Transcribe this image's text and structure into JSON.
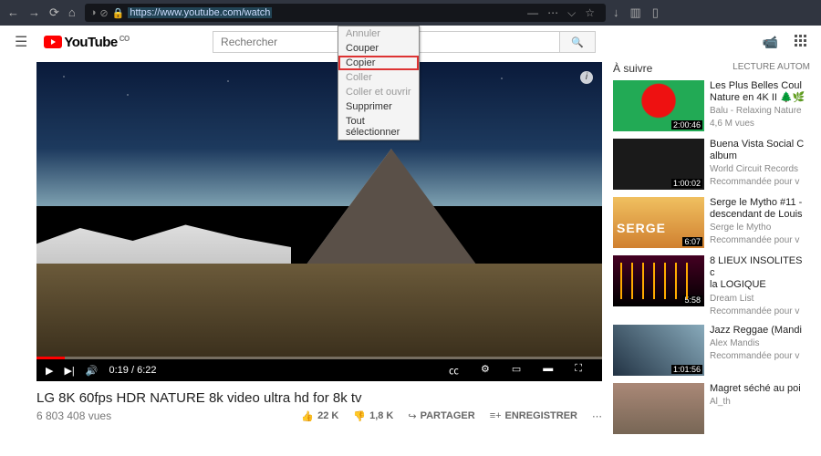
{
  "browser": {
    "url_visible": "https://www.youtube.com/watch",
    "nav": {
      "back": "←",
      "fwd": "→",
      "reload": "⟳",
      "home": "⌂"
    },
    "tail": {
      "reader": "—",
      "menu": "⋯",
      "pocket": "⌵",
      "star": "☆"
    },
    "right": {
      "download": "↓",
      "library": "▥",
      "sidebar": "▯"
    }
  },
  "context_menu": {
    "items": [
      "Annuler",
      "Couper",
      "Copier",
      "Coller",
      "Coller et ouvrir",
      "Supprimer",
      "Tout sélectionner"
    ],
    "highlighted": "Copier"
  },
  "yt": {
    "logo_text": "YouTube",
    "logo_tag": "CO",
    "search_placeholder": "Rechercher"
  },
  "video": {
    "title": "LG 8K 60fps HDR NATURE 8k video ultra hd for 8k tv",
    "views": "6 803 408 vues",
    "time": "0:19 / 6:22",
    "likes": "22 K",
    "dislikes": "1,8 K",
    "share": "PARTAGER",
    "save": "ENREGISTRER"
  },
  "sidebar": {
    "upnext": "À suivre",
    "autoplay": "LECTURE AUTOM",
    "items": [
      {
        "title": "Les Plus Belles Coul",
        "title2": "Nature en 4K II 🌲🌿",
        "channel": "Balu - Relaxing Nature",
        "meta": "4,6 M vues",
        "dur": "2:00:46"
      },
      {
        "title": "Buena Vista Social C",
        "title2": "album",
        "channel": "World Circuit Records",
        "meta": "Recommandée pour v",
        "dur": "1:00:02"
      },
      {
        "title": "Serge le Mytho #11 -",
        "title2": "descendant de Louis",
        "channel": "Serge le Mytho",
        "meta": "Recommandée pour v",
        "dur": "6:07"
      },
      {
        "title": "8 LIEUX INSOLITES c",
        "title2": "la LOGIQUE",
        "channel": "Dream List",
        "meta": "Recommandée pour v",
        "dur": "5:58"
      },
      {
        "title": "Jazz Reggae (Mandi",
        "title2": "",
        "channel": "Alex Mandis",
        "meta": "Recommandée pour v",
        "dur": "1:01:56"
      },
      {
        "title": "Magret séché au poi",
        "title2": "",
        "channel": "Al_th",
        "meta": "",
        "dur": ""
      }
    ]
  }
}
